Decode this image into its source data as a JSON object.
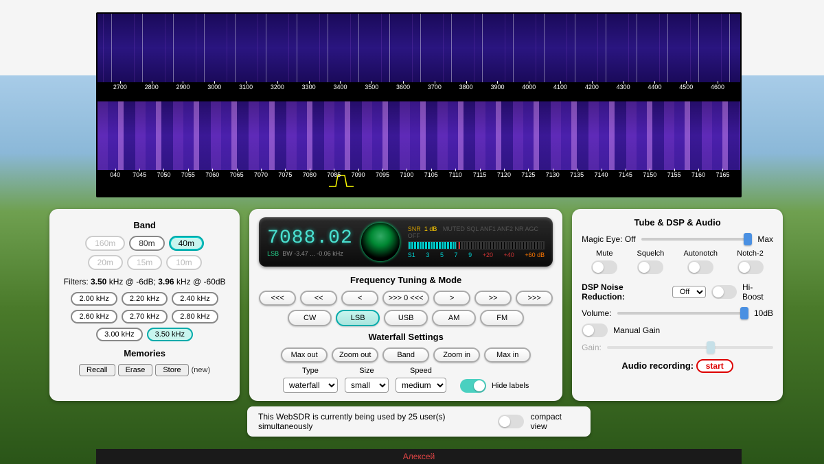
{
  "waterfall": {
    "scale_top": [
      "2700",
      "2800",
      "2900",
      "3000",
      "3100",
      "3200",
      "3300",
      "3400",
      "3500",
      "3600",
      "3700",
      "3800",
      "3900",
      "4000",
      "4100",
      "4200",
      "4300",
      "4400",
      "4500",
      "4600"
    ],
    "scale_bottom": [
      "040",
      "7045",
      "7050",
      "7055",
      "7060",
      "7065",
      "7070",
      "7075",
      "7080",
      "7085",
      "7090",
      "7095",
      "7100",
      "7105",
      "7110",
      "7115",
      "7120",
      "7125",
      "7130",
      "7135",
      "7140",
      "7145",
      "7150",
      "7155",
      "7160",
      "7165"
    ]
  },
  "band": {
    "heading": "Band",
    "items": [
      {
        "label": "160m",
        "state": "disabled"
      },
      {
        "label": "80m",
        "state": "normal"
      },
      {
        "label": "40m",
        "state": "active"
      },
      {
        "label": "20m",
        "state": "disabled"
      },
      {
        "label": "15m",
        "state": "disabled"
      },
      {
        "label": "10m",
        "state": "disabled"
      }
    ]
  },
  "filters": {
    "prefix": "Filters:",
    "bw1": "3.50",
    "bw1_unit": "kHz @ -6dB;",
    "bw2": "3.96",
    "bw2_unit": "kHz @ -60dB",
    "items": [
      "2.00 kHz",
      "2.20 kHz",
      "2.40 kHz",
      "2.60 kHz",
      "2.70 kHz",
      "2.80 kHz",
      "3.00 kHz",
      "3.50 kHz"
    ],
    "active_idx": 7
  },
  "memories": {
    "heading": "Memories",
    "recall": "Recall",
    "erase": "Erase",
    "store": "Store",
    "new": "(new)"
  },
  "tuner": {
    "freq": "7088.02",
    "mode": "LSB",
    "bw_label": "BW",
    "bw": "-3.47 ... -0.06 kHz",
    "snr_label": "SNR",
    "snr_val": "1 dB",
    "flags": [
      "MUTED",
      "SQL",
      "ANF1",
      "ANF2",
      "NR",
      "AGC OFF"
    ],
    "s_labels": [
      "S1",
      "3",
      "5",
      "7",
      "9",
      "+20",
      "+40",
      "+60 dB"
    ]
  },
  "freq_tuning": {
    "heading": "Frequency Tuning & Mode",
    "steps": [
      "<<<",
      "<<",
      "<",
      ">>> 0 <<<",
      ">",
      ">>",
      ">>>"
    ],
    "modes": [
      "CW",
      "LSB",
      "USB",
      "AM",
      "FM"
    ],
    "active_mode": 1
  },
  "wf_settings": {
    "heading": "Waterfall Settings",
    "buttons": [
      "Max out",
      "Zoom out",
      "Band",
      "Zoom in",
      "Max in"
    ],
    "type_label": "Type",
    "type": "waterfall",
    "size_label": "Size",
    "size": "small",
    "speed_label": "Speed",
    "speed": "medium",
    "hide": "Hide labels"
  },
  "right": {
    "heading": "Tube & DSP & Audio",
    "magic_eye": "Magic Eye: Off",
    "max": "Max",
    "mute": "Mute",
    "squelch": "Squelch",
    "autonotch": "Autonotch",
    "notch2": "Notch-2",
    "dsp_label": "DSP Noise Reduction:",
    "dsp_val": "Off",
    "hiboost": "Hi-Boost",
    "volume": "Volume:",
    "vol_val": "10dB",
    "manual_gain": "Manual Gain",
    "gain": "Gain:",
    "rec_label": "Audio recording:",
    "rec_btn": "start"
  },
  "footer": {
    "msg": "This WebSDR is currently being used by 25 user(s) simultaneously",
    "compact": "compact view"
  },
  "name": "Алексей"
}
